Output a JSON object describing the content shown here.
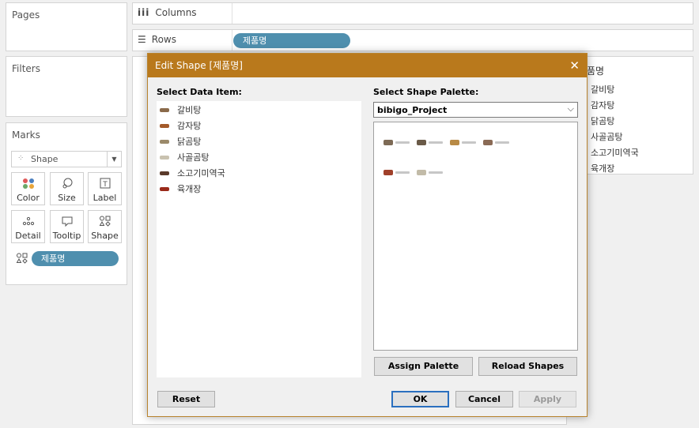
{
  "pages_panel": {
    "title": "Pages"
  },
  "filters_panel": {
    "title": "Filters"
  },
  "columns_shelf": {
    "label": "Columns"
  },
  "rows_shelf": {
    "label": "Rows",
    "pill": "제품명"
  },
  "marks_panel": {
    "title": "Marks",
    "mark_type": "Shape",
    "buttons": [
      {
        "label": "Color",
        "icon": "color-dots-icon"
      },
      {
        "label": "Size",
        "icon": "size-icon"
      },
      {
        "label": "Label",
        "icon": "label-icon"
      },
      {
        "label": "Detail",
        "icon": "detail-icon"
      },
      {
        "label": "Tooltip",
        "icon": "tooltip-icon"
      },
      {
        "label": "Shape",
        "icon": "shape-icon"
      }
    ],
    "shape_field": "제품명"
  },
  "legend": {
    "title_partial": "품명",
    "items": [
      "갈비탕",
      "감자탕",
      "닭곰탕",
      "사골곰탕",
      "소고기미역국",
      "육개장"
    ]
  },
  "dialog": {
    "title": "Edit Shape [제품명]",
    "select_data_item_label": "Select Data Item:",
    "select_palette_label": "Select Shape Palette:",
    "data_items": [
      {
        "label": "갈비탕",
        "color": "#8a6a4a"
      },
      {
        "label": "감자탕",
        "color": "#a35a2a"
      },
      {
        "label": "닭곰탕",
        "color": "#9b8a6a"
      },
      {
        "label": "사골곰탕",
        "color": "#c9c2b0"
      },
      {
        "label": "소고기미역국",
        "color": "#5a3a2a"
      },
      {
        "label": "육개장",
        "color": "#9a2a1a"
      }
    ],
    "palette_selected": "bibigo_Project",
    "palette_swatch_colors": [
      "#7d6a55",
      "#6a5a48",
      "#b88a45",
      "#8a6a55",
      "#a0402a",
      "#c2bba8"
    ],
    "buttons": {
      "assign_palette": "Assign Palette",
      "reload_shapes": "Reload Shapes",
      "reset": "Reset",
      "ok": "OK",
      "cancel": "Cancel",
      "apply": "Apply"
    }
  },
  "colors": {
    "dialog_title_bar": "#b9791c",
    "pill": "#4f8fae"
  }
}
